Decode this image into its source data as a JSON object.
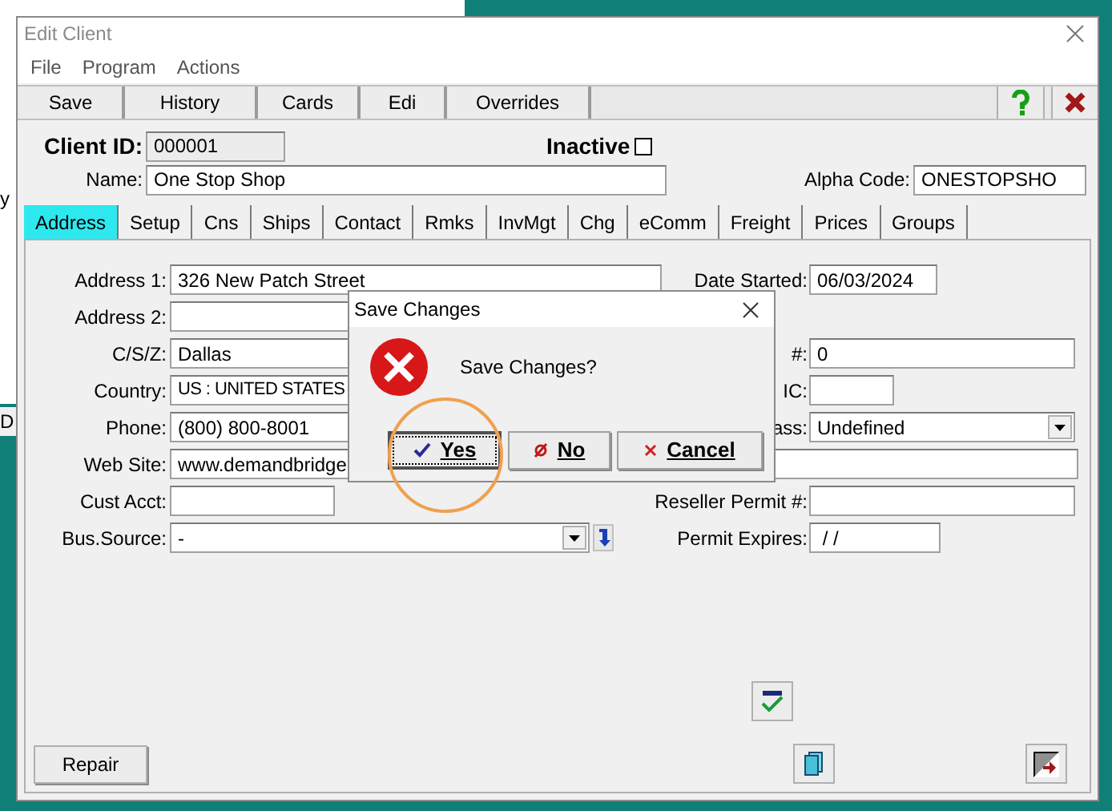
{
  "background": {
    "fragments": [
      "y",
      "D"
    ]
  },
  "window": {
    "title": "Edit Client"
  },
  "menu": [
    "File",
    "Program",
    "Actions"
  ],
  "toolbar": [
    "Save",
    "History",
    "Cards",
    "Edi",
    "Overrides"
  ],
  "header": {
    "client_id_label": "Client ID:",
    "client_id": "000001",
    "inactive_label": "Inactive",
    "inactive_checked": false,
    "name_label": "Name:",
    "name": "One Stop Shop",
    "alpha_label": "Alpha Code:",
    "alpha": "ONESTOPSHO"
  },
  "tabs": [
    {
      "label": "Address",
      "selected": true
    },
    {
      "label": "Setup",
      "selected": false
    },
    {
      "label": "Cns",
      "selected": false
    },
    {
      "label": "Ships",
      "selected": false
    },
    {
      "label": "Contact",
      "selected": false
    },
    {
      "label": "Rmks",
      "selected": false
    },
    {
      "label": "InvMgt",
      "selected": false
    },
    {
      "label": "Chg",
      "selected": false
    },
    {
      "label": "eComm",
      "selected": false
    },
    {
      "label": "Freight",
      "selected": false
    },
    {
      "label": "Prices",
      "selected": false
    },
    {
      "label": "Groups",
      "selected": false
    }
  ],
  "rows": [
    {
      "left": {
        "label": "Address 1:",
        "value": "326 New Patch Street",
        "kind": "text"
      },
      "right": {
        "label": "Date Started:",
        "value": "06/03/2024",
        "kind": "text"
      }
    },
    {
      "left": {
        "label": "Address 2:",
        "kind": "text"
      }
    },
    {
      "left": {
        "label": "C/S/Z:",
        "value": "Dallas",
        "kind": "text"
      },
      "right": {
        "label": "#:",
        "value": "0",
        "kind": "text"
      }
    },
    {
      "left": {
        "label": "Country:",
        "value": "US : UNITED STATES",
        "kind": "text"
      },
      "right": {
        "label": "IC:",
        "kind": "text"
      }
    },
    {
      "left": {
        "label": "Phone:",
        "value": "(800) 800-8001",
        "kind": "text"
      },
      "right": {
        "label": "ass:",
        "value": "Undefined",
        "kind": "select"
      }
    },
    {
      "left": {
        "label": "Web Site:",
        "value": "www.demandbridge",
        "kind": "wide"
      }
    },
    {
      "left": {
        "label": "Cust Acct:",
        "kind": "text"
      },
      "right": {
        "label": "Reseller Permit #:",
        "kind": "text"
      }
    },
    {
      "left": {
        "label": "Bus.Source:",
        "value": "-",
        "kind": "select"
      },
      "right": {
        "label": "Permit Expires:",
        "value": " / /",
        "kind": "text"
      }
    }
  ],
  "repair_button": "Repair",
  "dialog": {
    "title": "Save Changes",
    "message": "Save Changes?",
    "highlighted": true,
    "buttons": [
      {
        "label": "Yes",
        "kind": "yes",
        "selected": true
      },
      {
        "label": "No",
        "kind": "no",
        "selected": false
      },
      {
        "label": "Cancel",
        "kind": "cancel",
        "selected": false
      }
    ]
  }
}
